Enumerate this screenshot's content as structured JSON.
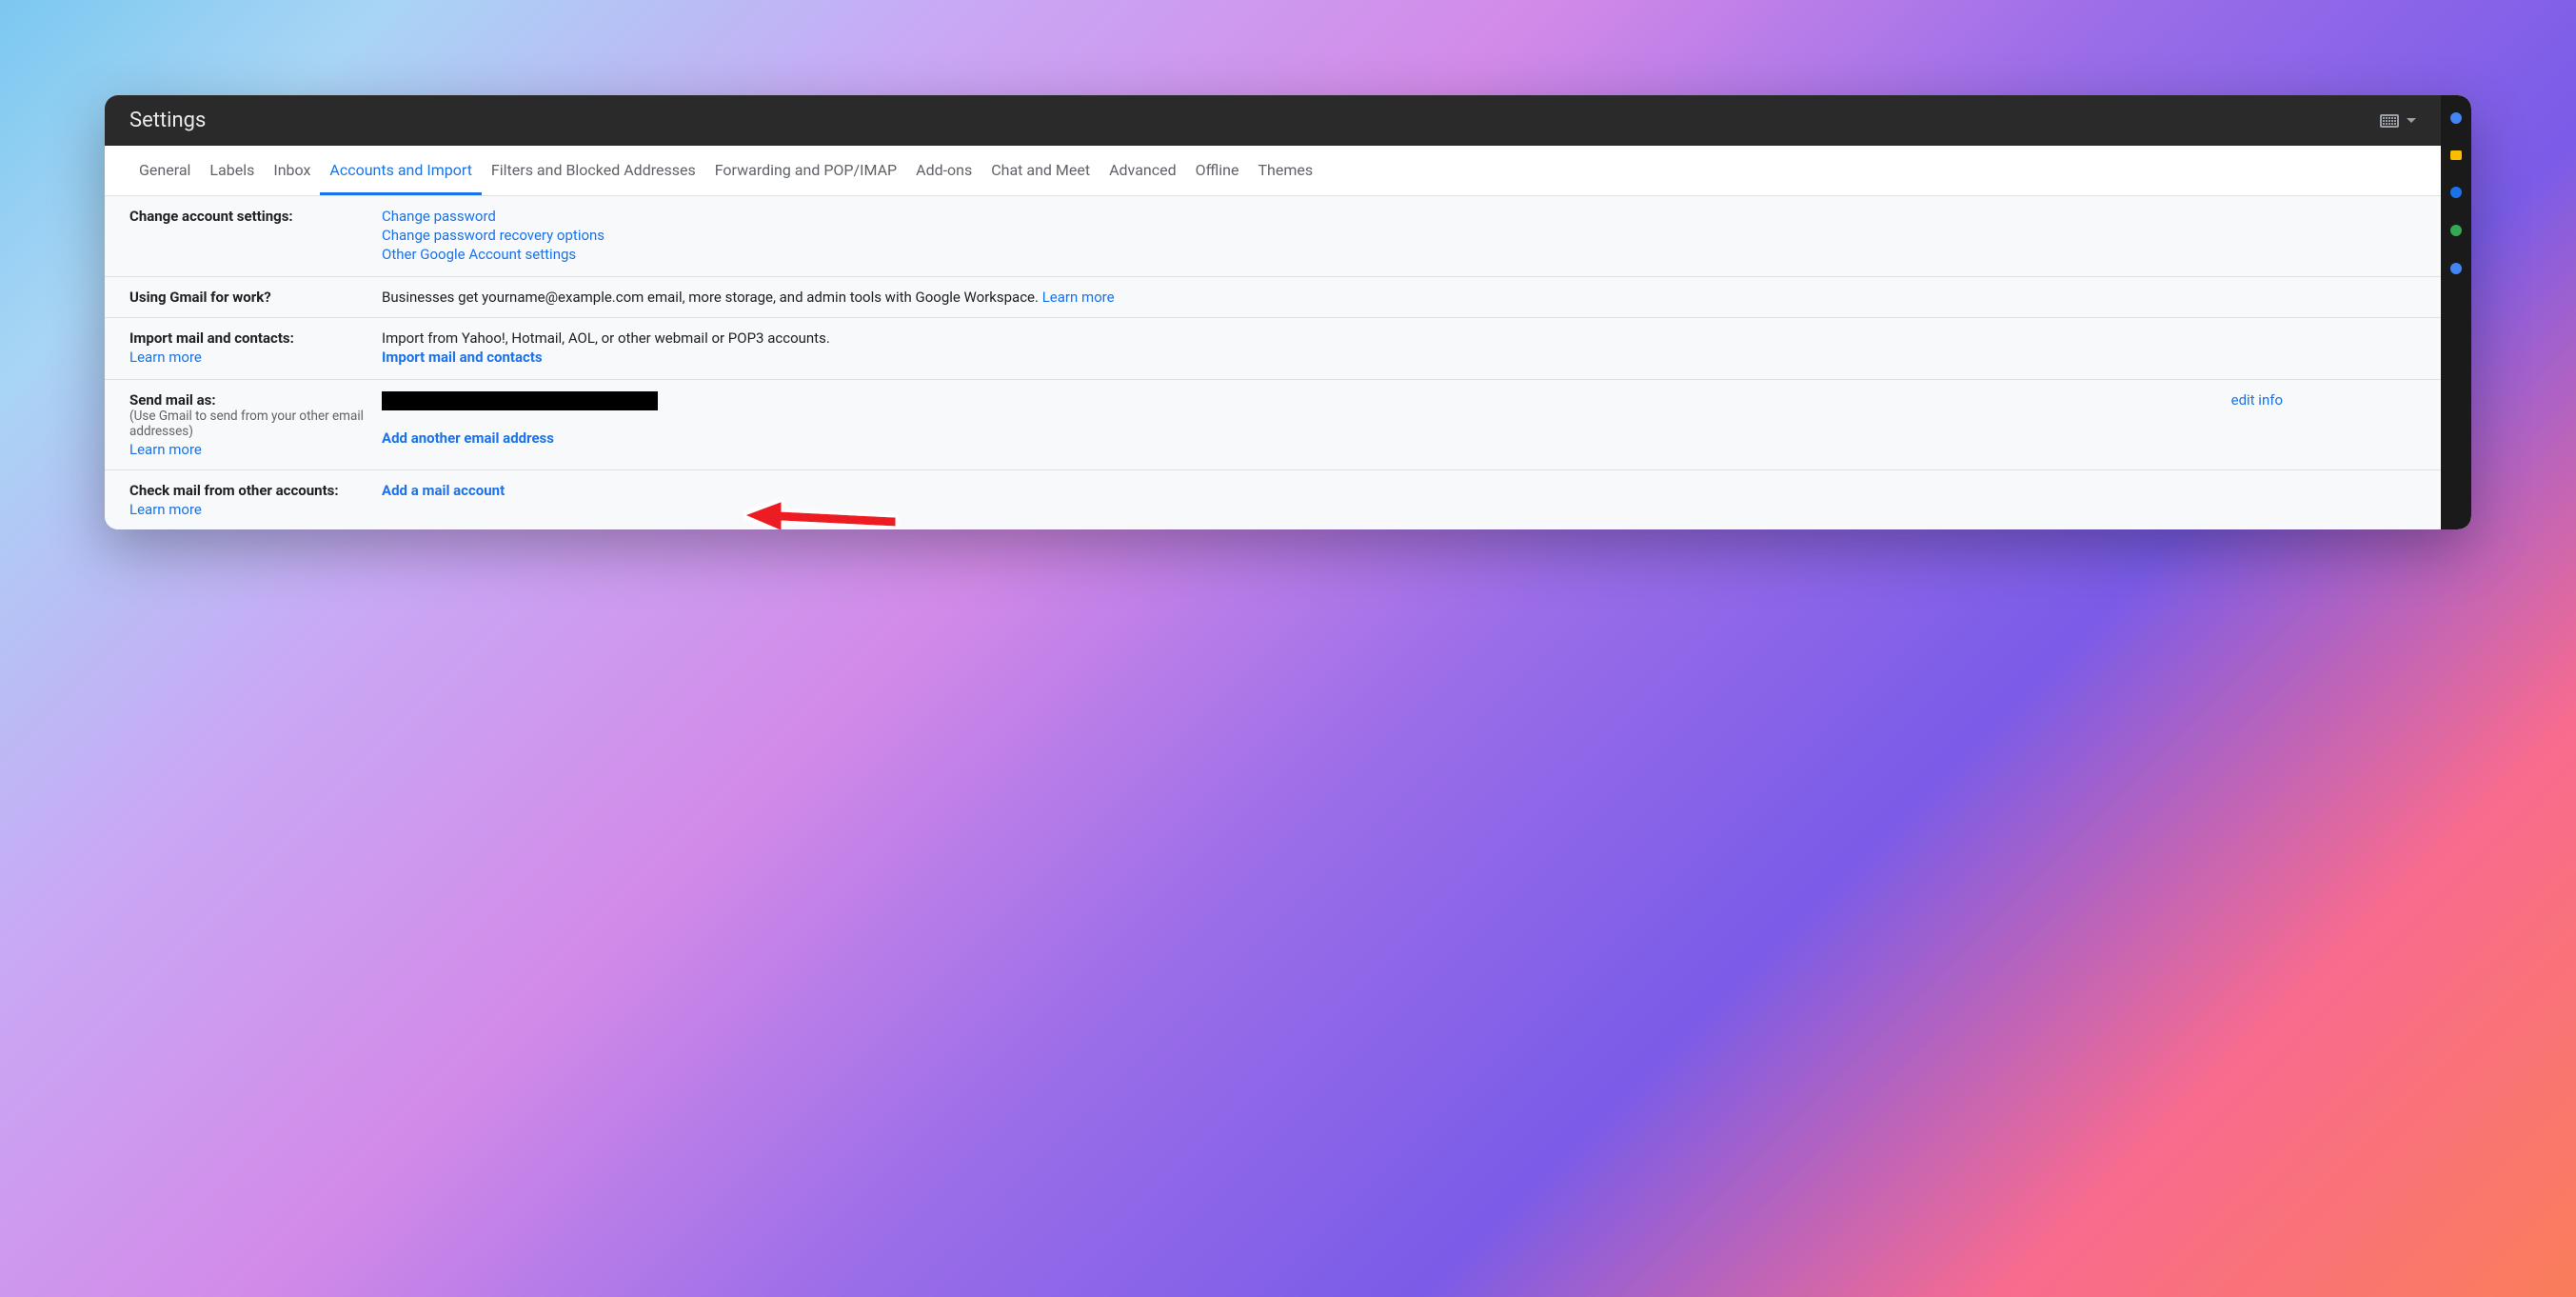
{
  "titlebar": {
    "title": "Settings"
  },
  "tabs": [
    {
      "label": "General",
      "active": false
    },
    {
      "label": "Labels",
      "active": false
    },
    {
      "label": "Inbox",
      "active": false
    },
    {
      "label": "Accounts and Import",
      "active": true
    },
    {
      "label": "Filters and Blocked Addresses",
      "active": false
    },
    {
      "label": "Forwarding and POP/IMAP",
      "active": false
    },
    {
      "label": "Add-ons",
      "active": false
    },
    {
      "label": "Chat and Meet",
      "active": false
    },
    {
      "label": "Advanced",
      "active": false
    },
    {
      "label": "Offline",
      "active": false
    },
    {
      "label": "Themes",
      "active": false
    }
  ],
  "sections": {
    "change_account": {
      "label": "Change account settings:",
      "links": {
        "change_password": "Change password",
        "recovery": "Change password recovery options",
        "other": "Other Google Account settings"
      }
    },
    "using_for_work": {
      "label": "Using Gmail for work?",
      "text": "Businesses get yourname@example.com email, more storage, and admin tools with Google Workspace. ",
      "learn_more": "Learn more"
    },
    "import_mail": {
      "label": "Import mail and contacts:",
      "learn_more": "Learn more",
      "text": "Import from Yahoo!, Hotmail, AOL, or other webmail or POP3 accounts.",
      "action": "Import mail and contacts"
    },
    "send_mail_as": {
      "label": "Send mail as:",
      "sublabel": "(Use Gmail to send from your other email addresses)",
      "learn_more": "Learn more",
      "action": "Add another email address",
      "edit_info": "edit info"
    },
    "check_mail": {
      "label": "Check mail from other accounts:",
      "learn_more": "Learn more",
      "action": "Add a mail account"
    }
  }
}
